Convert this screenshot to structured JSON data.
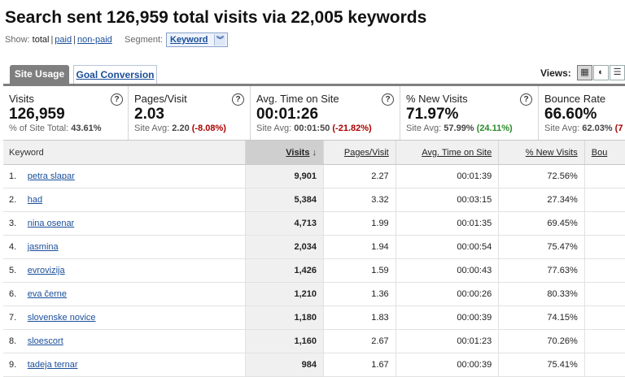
{
  "title": "Search sent 126,959 total visits via 22,005 keywords",
  "show": {
    "label": "Show:",
    "options": [
      "total",
      "paid",
      "non-paid"
    ],
    "separator": "|"
  },
  "segment": {
    "label": "Segment:",
    "value": "Keyword"
  },
  "tabs": [
    {
      "label": "Site Usage",
      "active": true
    },
    {
      "label": "Goal Conversion",
      "active": false
    }
  ],
  "views": {
    "label": "Views:",
    "icons": [
      "table-view-icon",
      "pie-view-icon",
      "bar-view-icon"
    ]
  },
  "metrics": [
    {
      "label": "Visits",
      "value": "126,959",
      "sub_prefix": "% of Site Total:",
      "sub_value": "43.61%",
      "sub_delta": ""
    },
    {
      "label": "Pages/Visit",
      "value": "2.03",
      "sub_prefix": "Site Avg:",
      "sub_value": "2.20",
      "sub_delta": "(-8.08%)"
    },
    {
      "label": "Avg. Time on Site",
      "value": "00:01:26",
      "sub_prefix": "Site Avg:",
      "sub_value": "00:01:50",
      "sub_delta": "(-21.82%)"
    },
    {
      "label": "% New Visits",
      "value": "71.97%",
      "sub_prefix": "Site Avg:",
      "sub_value": "57.99%",
      "sub_delta": "(24.11%)"
    },
    {
      "label": "Bounce Rate",
      "value": "66.60%",
      "sub_prefix": "Site Avg:",
      "sub_value": "62.03%",
      "sub_delta": "(7"
    }
  ],
  "table": {
    "headers": [
      "Keyword",
      "Visits",
      "Pages/Visit",
      "Avg. Time on Site",
      "% New Visits",
      "Bou"
    ],
    "sorted_arrow": "↓",
    "rows": [
      {
        "n": "1.",
        "keyword": "petra slapar",
        "visits": "9,901",
        "ppv": "2.27",
        "time": "00:01:39",
        "newv": "72.56%"
      },
      {
        "n": "2.",
        "keyword": "had",
        "visits": "5,384",
        "ppv": "3.32",
        "time": "00:03:15",
        "newv": "27.34%"
      },
      {
        "n": "3.",
        "keyword": "nina osenar",
        "visits": "4,713",
        "ppv": "1.99",
        "time": "00:01:35",
        "newv": "69.45%"
      },
      {
        "n": "4.",
        "keyword": "jasmina",
        "visits": "2,034",
        "ppv": "1.94",
        "time": "00:00:54",
        "newv": "75.47%"
      },
      {
        "n": "5.",
        "keyword": "evrovizija",
        "visits": "1,426",
        "ppv": "1.59",
        "time": "00:00:43",
        "newv": "77.63%"
      },
      {
        "n": "6.",
        "keyword": "eva černe",
        "visits": "1,210",
        "ppv": "1.36",
        "time": "00:00:26",
        "newv": "80.33%"
      },
      {
        "n": "7.",
        "keyword": "slovenske novice",
        "visits": "1,180",
        "ppv": "1.83",
        "time": "00:00:39",
        "newv": "74.15%"
      },
      {
        "n": "8.",
        "keyword": "sloescort",
        "visits": "1,160",
        "ppv": "2.67",
        "time": "00:01:23",
        "newv": "70.26%"
      },
      {
        "n": "9.",
        "keyword": "tadeja ternar",
        "visits": "984",
        "ppv": "1.67",
        "time": "00:00:39",
        "newv": "75.41%"
      }
    ]
  },
  "colors": {
    "link": "#1a4e9a",
    "negative": "#aa0000",
    "positive": "#2a8a2a",
    "tab_active": "#7f7f7f"
  }
}
